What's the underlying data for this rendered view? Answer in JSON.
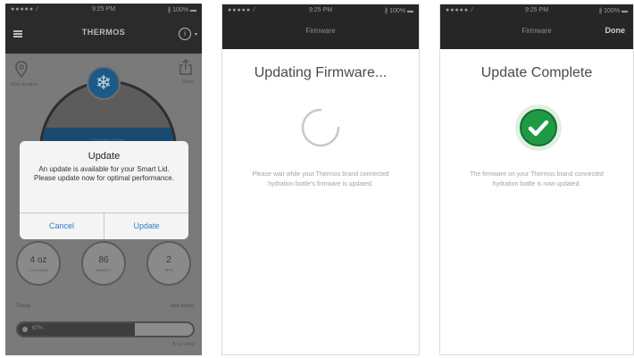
{
  "status": {
    "signal": "●●●●● ⁄",
    "time": "9:25 PM",
    "battery": "∦ 100% ▬"
  },
  "home": {
    "brand": "THERMOS",
    "location_label": "Mark location",
    "share_label": "Share",
    "band_text": "Hydration Bottle",
    "stats": [
      {
        "value": "4 oz",
        "label": "CONSUMED"
      },
      {
        "value": "86",
        "label": "AMBIENT"
      },
      {
        "value": "2",
        "label": "SIPS"
      }
    ],
    "today_label": "Today",
    "view_activity": "View Activity",
    "progress": {
      "percent_label": "67%",
      "fraction": 0.67
    },
    "oz_label": "8 oz / 64oz"
  },
  "dialog": {
    "title": "Update",
    "message": "An update is available for your Smart Lid. Please update now for optimal performance.",
    "cancel": "Cancel",
    "update": "Update"
  },
  "updating": {
    "nav_title": "Firmware",
    "heading": "Updating Firmware...",
    "body": "Please wait while your Thermos brand connected hydration bottle's firmware is updated."
  },
  "complete": {
    "nav_title": "Firmware",
    "done": "Done",
    "heading": "Update Complete",
    "body": "The firmware on your Thermos brand connected hydration bottle is now updated."
  },
  "colors": {
    "accent_blue": "#2f7bc8",
    "success_green": "#1f9a45",
    "dark_bar": "#262626"
  }
}
